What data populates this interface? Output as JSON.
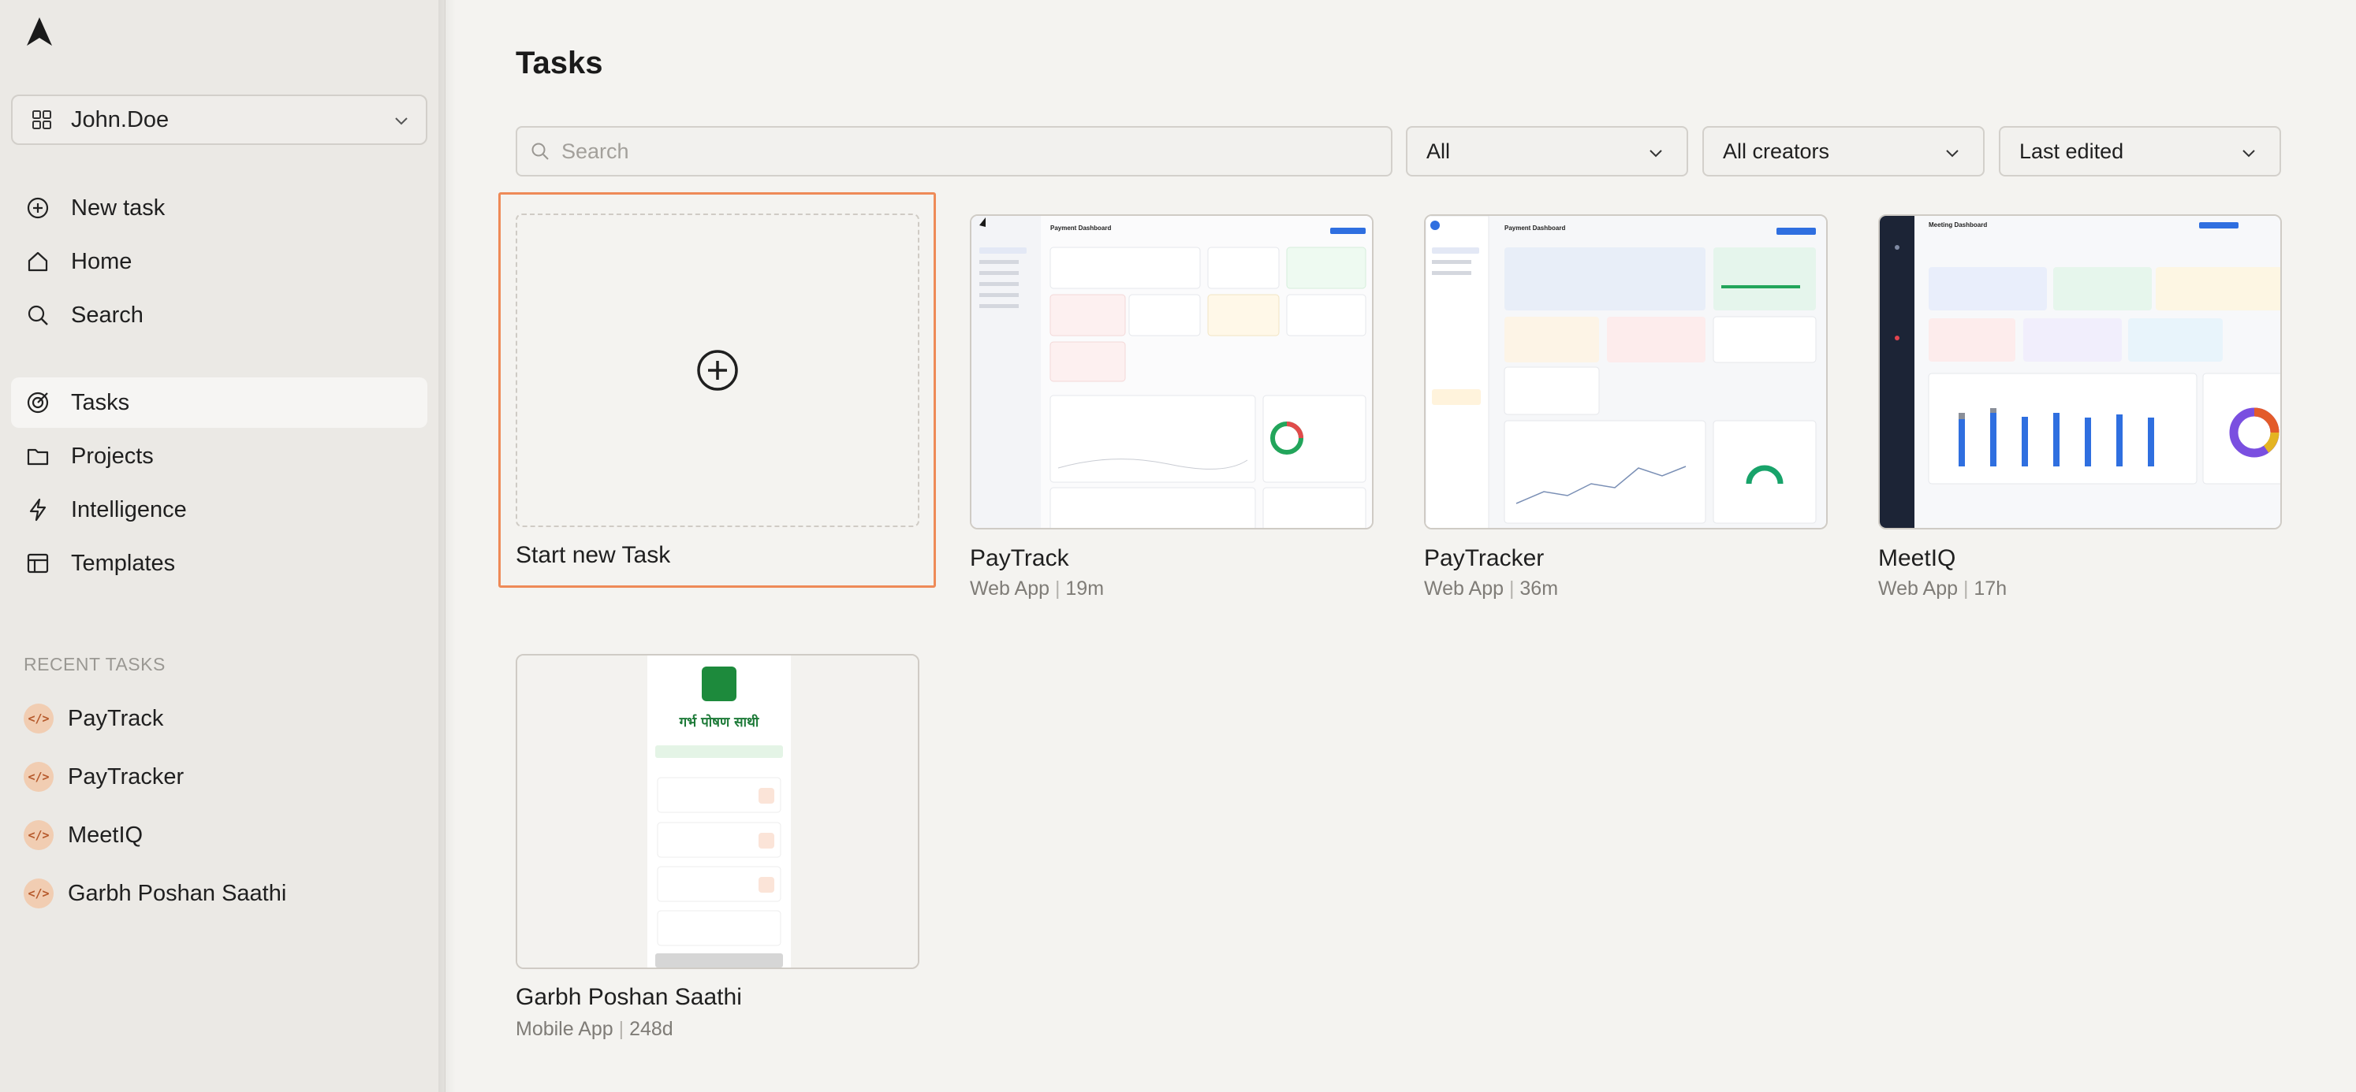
{
  "sidebar": {
    "workspace_name": "John.Doe",
    "nav_items": [
      {
        "label": "New task",
        "icon": "plus-circle-icon"
      },
      {
        "label": "Home",
        "icon": "home-icon"
      },
      {
        "label": "Search",
        "icon": "search-icon"
      },
      {
        "label": "Tasks",
        "icon": "target-icon",
        "active": true
      },
      {
        "label": "Projects",
        "icon": "folder-icon"
      },
      {
        "label": "Intelligence",
        "icon": "bolt-icon"
      },
      {
        "label": "Templates",
        "icon": "layout-icon"
      }
    ],
    "recent_title": "RECENT TASKS",
    "recent_items": [
      {
        "label": "PayTrack",
        "icon_glyph": "</>"
      },
      {
        "label": "PayTracker",
        "icon_glyph": "</>"
      },
      {
        "label": "MeetIQ",
        "icon_glyph": "</>"
      },
      {
        "label": "Garbh Poshan Saathi",
        "icon_glyph": "</>"
      }
    ]
  },
  "main": {
    "title": "Tasks",
    "search_placeholder": "Search",
    "filters": {
      "type": "All",
      "creators": "All creators",
      "sort": "Last edited"
    },
    "new_task_label": "Start new Task",
    "cards": [
      {
        "title": "PayTrack",
        "type": "Web App",
        "age": "19m",
        "thumb_heading": "Payment Dashboard"
      },
      {
        "title": "PayTracker",
        "type": "Web App",
        "age": "36m",
        "thumb_heading": "Payment Dashboard"
      },
      {
        "title": "MeetIQ",
        "type": "Web App",
        "age": "17h",
        "thumb_heading": "Meeting Dashboard"
      },
      {
        "title": "Garbh Poshan Saathi",
        "type": "Mobile App",
        "age": "248d",
        "thumb_heading": "गर्भ पोषण साथी"
      }
    ]
  },
  "colors": {
    "accent_orange": "#ee8a57",
    "sidebar_bg": "#ebe9e5",
    "main_bg": "#f4f3f0"
  }
}
